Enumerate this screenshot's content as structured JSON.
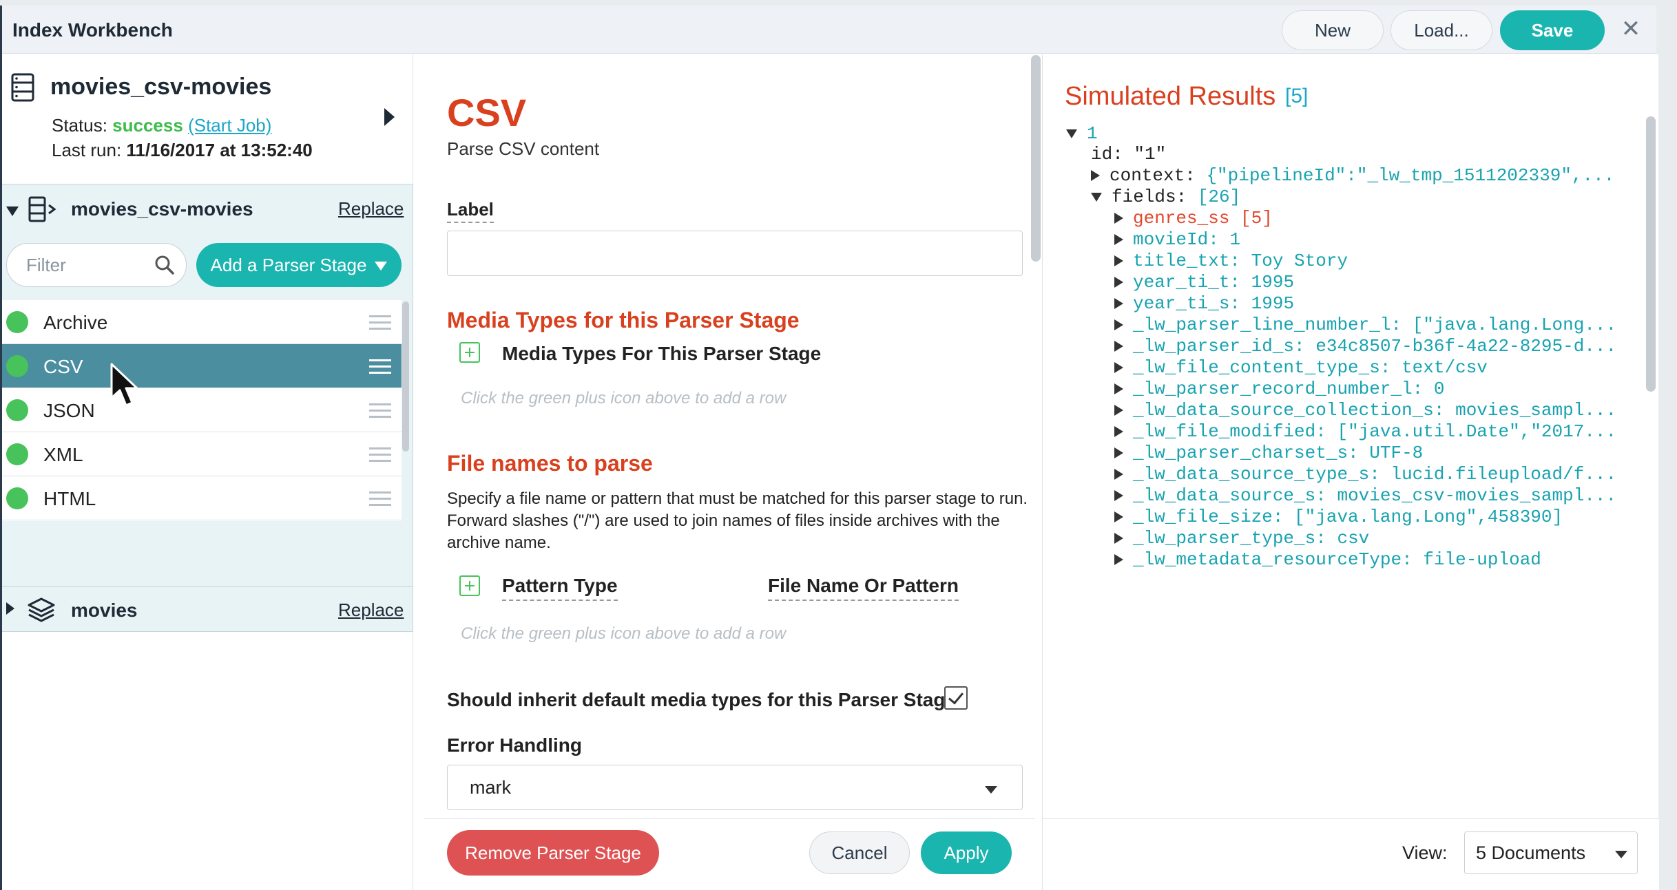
{
  "window": {
    "title": "Index Workbench"
  },
  "toolbar": {
    "new_label": "New",
    "load_label": "Load...",
    "save_label": "Save",
    "close_icon": "close-icon"
  },
  "job": {
    "name": "movies_csv-movies",
    "status_label": "Status:",
    "status_value": "success",
    "start_job": "(Start Job)",
    "last_run_label": "Last run:",
    "last_run_value": "11/16/2017 at 13:52:40"
  },
  "pipeline": {
    "name": "movies_csv-movies",
    "replace_label": "Replace",
    "filter_placeholder": "Filter",
    "add_stage_label": "Add a Parser Stage",
    "stages": [
      {
        "label": "Archive",
        "selected": false
      },
      {
        "label": "CSV",
        "selected": true
      },
      {
        "label": "JSON",
        "selected": false
      },
      {
        "label": "XML",
        "selected": false
      },
      {
        "label": "HTML",
        "selected": false
      },
      {
        "label": "",
        "selected": false
      }
    ]
  },
  "schema": {
    "name": "movies",
    "replace_label": "Replace"
  },
  "stage_editor": {
    "title": "CSV",
    "description": "Parse CSV content",
    "label_field_label": "Label",
    "label_value": "",
    "media_section_title": "Media Types for this Parser Stage",
    "media_table_header": "Media Types For This Parser Stage",
    "media_hint": "Click the green plus icon above to add a row",
    "files_section_title": "File names to parse",
    "files_description": "Specify a file name or pattern that must be matched for this parser stage to run. Forward slashes (\"/\") are used to join names of files inside archives with the archive name.",
    "pattern_type_header": "Pattern Type",
    "file_pattern_header": "File Name Or Pattern",
    "files_hint": "Click the green plus icon above to add a row",
    "inherit_label": "Should inherit default media types for this Parser Stage",
    "inherit_checked": true,
    "error_handling_label": "Error Handling",
    "error_handling_value": "mark",
    "remove_label": "Remove Parser Stage",
    "cancel_label": "Cancel",
    "apply_label": "Apply"
  },
  "results": {
    "title": "Simulated Results",
    "count": "[5]",
    "view_label": "View:",
    "view_value": "5 Documents",
    "doc_index": "1",
    "id_key": "id:",
    "id_value": "\"1\"",
    "context_key": "context:",
    "context_value": "{\"pipelineId\":\"_lw_tmp_1511202339\",...",
    "fields_key": "fields:",
    "fields_count": "[26]",
    "fields": [
      {
        "key": "genres_ss",
        "value": "[5]",
        "style": "red"
      },
      {
        "key": "movieId:",
        "value": "1",
        "style": "teal"
      },
      {
        "key": "title_txt:",
        "value": "Toy Story",
        "style": "teal"
      },
      {
        "key": "year_ti_t:",
        "value": "1995",
        "style": "teal"
      },
      {
        "key": "year_ti_s:",
        "value": "1995",
        "style": "teal"
      },
      {
        "key": "_lw_parser_line_number_l:",
        "value": "[\"java.lang.Long...",
        "style": "teal"
      },
      {
        "key": "_lw_parser_id_s:",
        "value": "e34c8507-b36f-4a22-8295-d...",
        "style": "teal"
      },
      {
        "key": "_lw_file_content_type_s:",
        "value": "text/csv",
        "style": "teal"
      },
      {
        "key": "_lw_parser_record_number_l:",
        "value": "0",
        "style": "teal"
      },
      {
        "key": "_lw_data_source_collection_s:",
        "value": "movies_sampl...",
        "style": "teal"
      },
      {
        "key": "_lw_file_modified:",
        "value": "[\"java.util.Date\",\"2017...",
        "style": "teal"
      },
      {
        "key": "_lw_parser_charset_s:",
        "value": "UTF-8",
        "style": "teal"
      },
      {
        "key": "_lw_data_source_type_s:",
        "value": "lucid.fileupload/f...",
        "style": "teal"
      },
      {
        "key": "_lw_data_source_s:",
        "value": "movies_csv-movies_sampl...",
        "style": "teal"
      },
      {
        "key": "_lw_file_size:",
        "value": "[\"java.lang.Long\",458390]",
        "style": "teal"
      },
      {
        "key": "_lw_parser_type_s:",
        "value": "csv",
        "style": "teal"
      },
      {
        "key": "_lw_metadata_resourceType:",
        "value": "file-upload",
        "style": "teal"
      }
    ]
  },
  "colors": {
    "accent": "#1bb5b0",
    "danger": "#de5254",
    "heading": "#d8401e",
    "success": "#3dbb4b",
    "selected_row": "#4a8ea0"
  }
}
